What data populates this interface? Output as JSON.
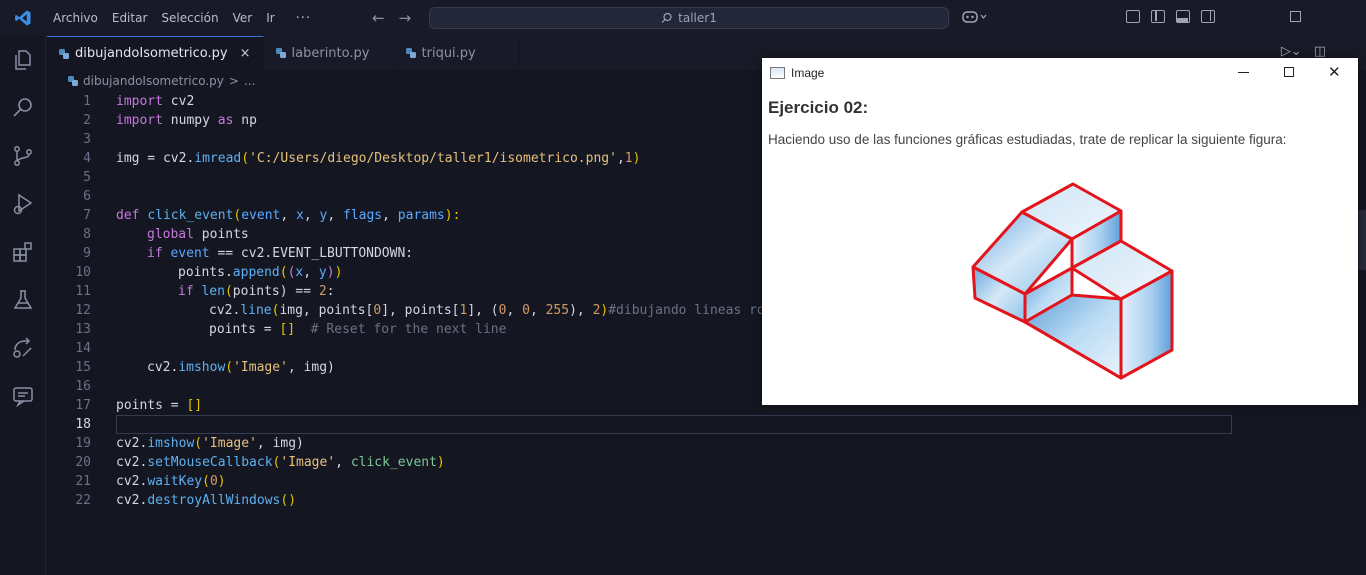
{
  "menu": {
    "items": [
      "Archivo",
      "Editar",
      "Selección",
      "Ver",
      "Ir"
    ],
    "more": "···"
  },
  "search": {
    "text": "taller1"
  },
  "tabs": [
    {
      "label": "dibujandoIsometrico.py",
      "active": true
    },
    {
      "label": "laberinto.py",
      "active": false
    },
    {
      "label": "triqui.py",
      "active": false
    }
  ],
  "tab_close": "×",
  "breadcrumb": {
    "file": "dibujandoIsometrico.py",
    "sep": ">",
    "more": "..."
  },
  "editor": {
    "line_numbers": [
      "1",
      "2",
      "3",
      "4",
      "5",
      "6",
      "7",
      "8",
      "9",
      "10",
      "11",
      "12",
      "13",
      "14",
      "15",
      "16",
      "17",
      "18",
      "19",
      "20",
      "21",
      "22"
    ],
    "current_line": "18",
    "code": {
      "l1": [
        "import",
        " cv2"
      ],
      "l2": [
        "import",
        " numpy ",
        "as",
        " np"
      ],
      "l4": [
        "img = cv2.",
        "imread",
        "(",
        "'C:/Users/diego/Desktop/taller1/isometrico.png'",
        ",",
        "1",
        ")"
      ],
      "l7": [
        "def",
        " ",
        "click_event",
        "(",
        "event",
        ", ",
        "x",
        ", ",
        "y",
        ", ",
        "flags",
        ", ",
        "params",
        "):"
      ],
      "l8": [
        "global",
        " points"
      ],
      "l9": [
        "if",
        " ",
        "event",
        " == cv2.EVENT_LBUTTONDOWN:"
      ],
      "l10": [
        "points.",
        "append",
        "(",
        "(",
        "x",
        ", ",
        "y",
        ")",
        ")"
      ],
      "l11": [
        "if",
        " ",
        "len",
        "(",
        "points",
        ") == ",
        "2",
        ":"
      ],
      "l12": [
        "cv2.",
        "line",
        "(",
        "img, points[",
        "0",
        "], points[",
        "1",
        "], (",
        "0",
        ", ",
        "0",
        ", ",
        "255",
        "), ",
        "2",
        ")",
        "#dibujando lineas roj"
      ],
      "l13": [
        "points = ",
        "[]",
        "  # Reset for the next line"
      ],
      "l15": [
        "cv2.",
        "imshow",
        "(",
        "'Image'",
        ", img)"
      ],
      "l17": [
        "points = ",
        "[]"
      ],
      "l19": [
        "cv2.",
        "imshow",
        "(",
        "'Image'",
        ", img)"
      ],
      "l20": [
        "cv2.",
        "setMouseCallback",
        "(",
        "'Image'",
        ", ",
        "click_event",
        ")"
      ],
      "l21": [
        "cv2.",
        "waitKey",
        "(",
        "0",
        ")"
      ],
      "l22": [
        "cv2.",
        "destroyAllWindows",
        "()"
      ]
    }
  },
  "image_window": {
    "title": "Image",
    "heading": "Ejercicio 02:",
    "description": "Haciendo uso de las funciones gráficas estudiadas, trate de replicar la siguiente figura:",
    "controls": {
      "close": "✕"
    }
  },
  "colors": {
    "accent": "#3d6fd6",
    "outline_red": "#e3141b",
    "solid_blue": "#a8d0ef"
  }
}
